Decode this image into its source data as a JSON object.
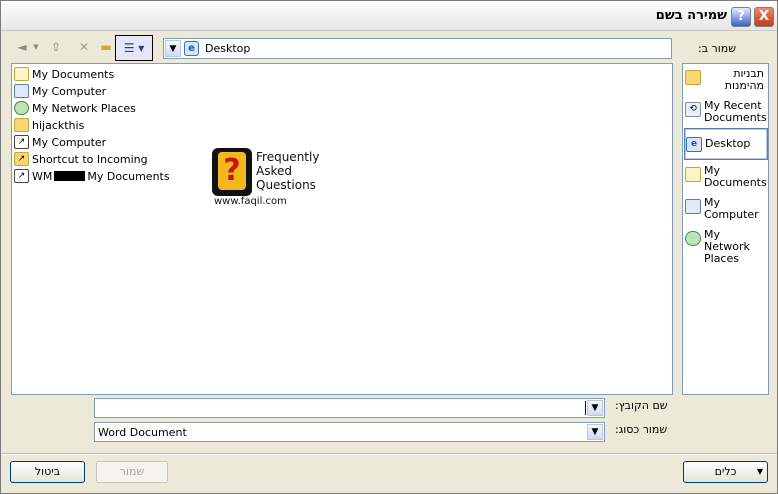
{
  "dialog": {
    "title": "שמירה בשם",
    "help_glyph": "?",
    "close_glyph": "X"
  },
  "location_bar": {
    "label": "שמור ב:",
    "current": "Desktop",
    "dropdown_glyph": "▼"
  },
  "toolbar": {
    "icons": [
      "back-icon",
      "dropdown-icon",
      "up-folder-icon",
      "delete-icon",
      "new-folder-icon",
      "views-menu-icon"
    ]
  },
  "file_list": {
    "items": [
      {
        "label": "My Documents",
        "icon": "my-documents-icon"
      },
      {
        "label": "My Computer",
        "icon": "my-computer-icon"
      },
      {
        "label": "My Network Places",
        "icon": "network-places-icon"
      },
      {
        "label": "hijackthis",
        "icon": "folder-icon"
      },
      {
        "label": "My Computer",
        "icon": "my-computer-shortcut-icon"
      },
      {
        "label": "Shortcut to Incoming",
        "icon": "folder-shortcut-icon"
      },
      {
        "label_prefix": "WM",
        "label_suffix": "My Documents",
        "icon": "documents-shortcut-icon"
      }
    ]
  },
  "watermark": {
    "line1": "Frequently",
    "line2": "Asked",
    "line3": "Questions",
    "url": "www.faqil.com",
    "logo_glyph": "?"
  },
  "places_bar": [
    {
      "label": "תבניות מהימנות",
      "icon": "templates-folder-icon"
    },
    {
      "label": "My Recent Documents",
      "icon": "recent-documents-icon"
    },
    {
      "label": "Desktop",
      "icon": "desktop-icon",
      "selected": true
    },
    {
      "label": "My Documents",
      "icon": "my-documents-icon"
    },
    {
      "label": "My Computer",
      "icon": "my-computer-icon"
    },
    {
      "label": "My Network Places",
      "icon": "network-places-icon"
    }
  ],
  "form": {
    "filename_label": "שם הקובץ:",
    "filename_value": "",
    "filetype_label": "שמור כסוג:",
    "filetype_value": "Word Document"
  },
  "buttons": {
    "tools": "כלים",
    "save": "שמור",
    "cancel": "ביטול"
  }
}
